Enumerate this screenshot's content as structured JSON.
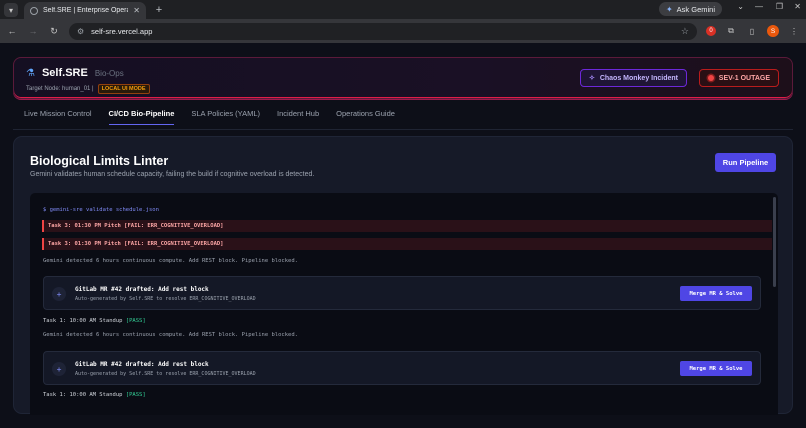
{
  "browser": {
    "tab_title": "Self.SRE | Enterprise Operations",
    "tab_close": "✕",
    "new_tab": "+",
    "ask_gemini": "Ask Gemini",
    "url": "self-sre.vercel.app",
    "profile_initial": "S",
    "ext_badge": "0"
  },
  "header": {
    "brand_name": "Self.SRE",
    "brand_sub": "Bio-Ops",
    "target_node": "Target Node: human_01 |",
    "local_badge": "LOCAL UI MODE",
    "chaos_button": "Chaos Monkey Incident",
    "sev_button": "SEV-1 OUTAGE"
  },
  "nav": {
    "tabs": [
      {
        "label": "Live Mission Control"
      },
      {
        "label": "CI/CD Bio-Pipeline"
      },
      {
        "label": "SLA Policies (YAML)"
      },
      {
        "label": "Incident Hub"
      },
      {
        "label": "Operations Guide"
      }
    ],
    "active": "CI/CD Bio-Pipeline"
  },
  "main": {
    "title": "Biological Limits Linter",
    "subtitle": "Gemini validates human schedule capacity, failing the build if cognitive overload is detected.",
    "run_button": "Run Pipeline"
  },
  "terminal": {
    "command": "$ gemini-sre validate schedule.json",
    "errors": [
      "Task 3: 01:30 PM Pitch [FAIL: ERR_COGNITIVE_OVERLOAD]",
      "Task 3: 01:30 PM Pitch [FAIL: ERR_COGNITIVE_OVERLOAD]"
    ],
    "info_1": "Gemini detected 6 hours continuous compute. Add REST block. Pipeline blocked.",
    "mr_1": {
      "title": "GitLab MR #42 drafted: Add rest block",
      "subtitle": "Auto-generated by Self.SRE to resolve ERR_COGNITIVE_OVERLOAD",
      "button": "Merge MR & Solve"
    },
    "task_1": "Task 1: 10:00 AM Standup",
    "pass_1": "[PASS]",
    "info_2": "Gemini detected 6 hours continuous compute. Add REST block. Pipeline blocked.",
    "mr_2": {
      "title": "GitLab MR #42 drafted: Add rest block",
      "subtitle": "Auto-generated by Self.SRE to resolve ERR_COGNITIVE_OVERLOAD",
      "button": "Merge MR & Solve"
    },
    "task_2": "Task 1: 10:00 AM Standup",
    "pass_2": "[PASS]"
  }
}
